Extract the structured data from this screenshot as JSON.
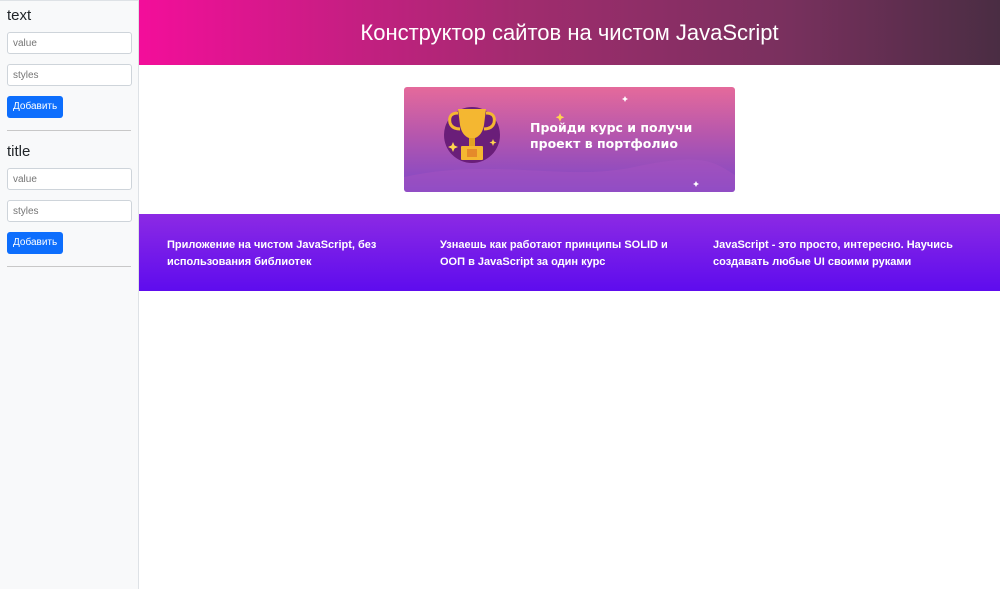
{
  "sidebar": {
    "forms": [
      {
        "title": "text",
        "value_placeholder": "value",
        "styles_placeholder": "styles",
        "button_label": "Добавить"
      },
      {
        "title": "title",
        "value_placeholder": "value",
        "styles_placeholder": "styles",
        "button_label": "Добавить"
      }
    ]
  },
  "header": {
    "title": "Конструктор сайтов на чистом JavaScript"
  },
  "banner": {
    "text": "Пройди курс и получи проект в портфолио"
  },
  "columns": [
    "Приложение на чистом JavaScript, без использования библиотек",
    "Узнаешь как работают принципы SOLID и ООП в JavaScript за один курс",
    "JavaScript - это просто, интересно. Научись создавать любые UI своими руками"
  ],
  "colors": {
    "header_start": "#f30e9a",
    "header_end": "#4a2d43",
    "columns_top": "#8c2ae4",
    "columns_bottom": "#5e0cee",
    "button": "#0d6efd"
  }
}
